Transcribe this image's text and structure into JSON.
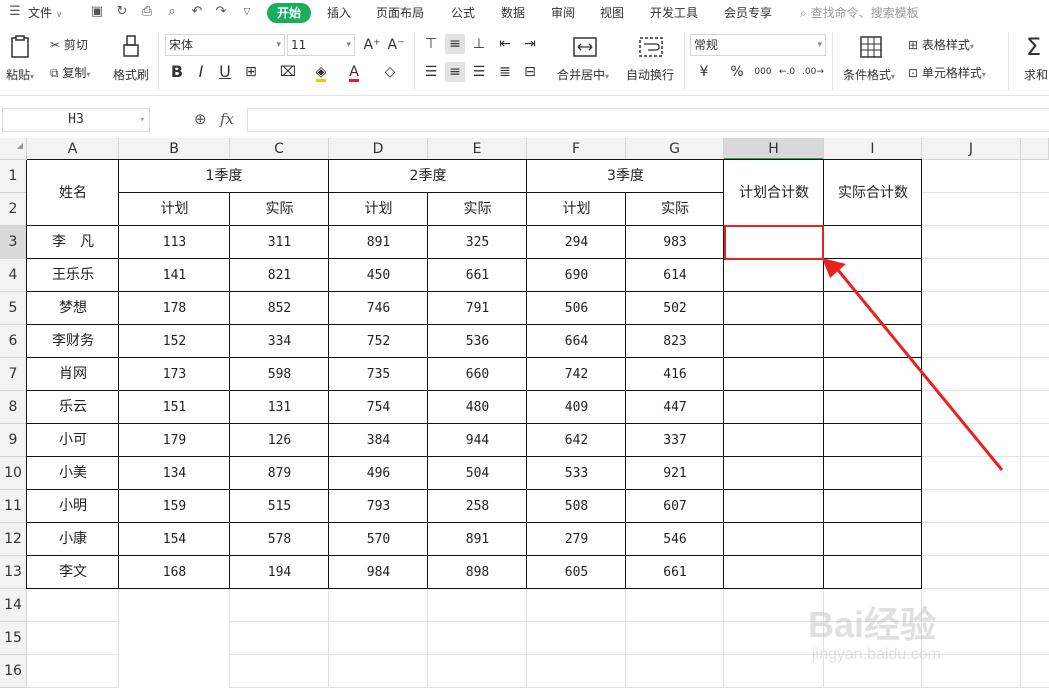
{
  "menu": {
    "file_label": "文件",
    "tabs": [
      "开始",
      "插入",
      "页面布局",
      "公式",
      "数据",
      "审阅",
      "视图",
      "开发工具",
      "会员专享"
    ],
    "search_placeholder": "查找命令、搜索模板"
  },
  "ribbon": {
    "paste": "粘贴",
    "cut": "剪切",
    "copy": "复制",
    "format_painter": "格式刷",
    "font_name": "宋体",
    "font_size": "11",
    "merge_center": "合并居中",
    "wrap_text": "自动换行",
    "number_format": "常规",
    "conditional_format": "条件格式",
    "table_style": "表格样式",
    "cell_style": "单元格样式",
    "sum": "求和"
  },
  "formula_bar": {
    "name_box": "H3",
    "fx": "fx",
    "content": ""
  },
  "sheet": {
    "columns": [
      "A",
      "B",
      "C",
      "D",
      "E",
      "F",
      "G",
      "H",
      "I",
      "J"
    ],
    "rows": [
      "1",
      "2",
      "3",
      "4",
      "5",
      "6",
      "7",
      "8",
      "9",
      "10",
      "11",
      "12",
      "13",
      "14",
      "15",
      "16"
    ],
    "selected_cell": "H3",
    "header": {
      "name": "姓名",
      "q1": "1季度",
      "q2": "2季度",
      "q3": "3季度",
      "plan": "计划",
      "actual": "实际",
      "plan_total": "计划合计数",
      "actual_total": "实际合计数"
    },
    "data": [
      {
        "name": "李　凡",
        "values": [
          113,
          311,
          891,
          325,
          294,
          983
        ]
      },
      {
        "name": "王乐乐",
        "values": [
          141,
          821,
          450,
          661,
          690,
          614
        ]
      },
      {
        "name": "梦想",
        "values": [
          178,
          852,
          746,
          791,
          506,
          502
        ]
      },
      {
        "name": "李财务",
        "values": [
          152,
          334,
          752,
          536,
          664,
          823
        ]
      },
      {
        "name": "肖网",
        "values": [
          173,
          598,
          735,
          660,
          742,
          416
        ]
      },
      {
        "name": "乐云",
        "values": [
          151,
          131,
          754,
          480,
          409,
          447
        ]
      },
      {
        "name": "小可",
        "values": [
          179,
          126,
          384,
          944,
          642,
          337
        ]
      },
      {
        "name": "小美",
        "values": [
          134,
          879,
          496,
          504,
          533,
          921
        ]
      },
      {
        "name": "小明",
        "values": [
          159,
          515,
          793,
          258,
          508,
          607
        ]
      },
      {
        "name": "小康",
        "values": [
          154,
          578,
          570,
          891,
          279,
          546
        ]
      },
      {
        "name": "李文",
        "values": [
          168,
          194,
          984,
          898,
          605,
          661
        ]
      }
    ]
  },
  "watermark": {
    "brand": "Bai经验",
    "url": "jingyan.baidu.com"
  },
  "colors": {
    "accent_green": "#1aad5f",
    "highlight_red": "#e8231f",
    "header_gray": "#f3f3f3"
  }
}
